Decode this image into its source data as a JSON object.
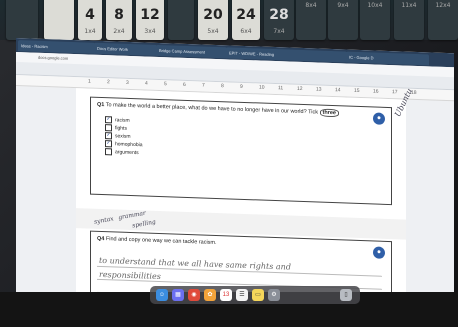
{
  "cards": [
    {
      "big": "",
      "small": "",
      "dark": true
    },
    {
      "big": "",
      "small": "",
      "dark": false
    },
    {
      "big": "4",
      "small": "1x4",
      "dark": false
    },
    {
      "big": "8",
      "small": "2x4",
      "dark": false
    },
    {
      "big": "12",
      "small": "3x4",
      "dark": false
    },
    {
      "big": "",
      "small": "",
      "dark": true
    },
    {
      "big": "20",
      "small": "5x4",
      "dark": false
    },
    {
      "big": "24",
      "small": "6x4",
      "dark": false
    },
    {
      "big": "28",
      "small": "7x4",
      "dark": true
    },
    {
      "big": "",
      "small": "8x4",
      "dark": true
    },
    {
      "big": "",
      "small": "9x4",
      "dark": true
    },
    {
      "big": "",
      "small": "10x4",
      "dark": true
    },
    {
      "big": "",
      "small": "11x4",
      "dark": true
    },
    {
      "big": "",
      "small": "12x4",
      "dark": true
    }
  ],
  "browser": {
    "tabs": [
      "Ideas - Racism",
      "Docs Editor Work",
      "Bridge Camp Assessment",
      "EPIT - WD/WE - Reading",
      "IC - Google D"
    ],
    "url": "docs.google.com"
  },
  "ruler": [
    "1",
    "2",
    "3",
    "4",
    "5",
    "6",
    "7",
    "8",
    "9",
    "10",
    "11",
    "12",
    "13",
    "14",
    "15",
    "16",
    "17",
    "18"
  ],
  "q1": {
    "number": "Q1",
    "text_a": "To make the world a better place, what do we have to no longer have in our world? Tick",
    "tick_word": "three",
    "options": [
      {
        "label": "racism",
        "checked": true
      },
      {
        "label": "fights",
        "checked": false
      },
      {
        "label": "sexism",
        "checked": true
      },
      {
        "label": "homophobia",
        "checked": true
      },
      {
        "label": "arguments",
        "checked": false
      }
    ],
    "margin_note": "Ubuntu"
  },
  "q4": {
    "number": "Q4",
    "text": "Find and copy one way we can tackle racism.",
    "margin_notes": [
      "syntax",
      "grammar",
      "spelling"
    ],
    "answer_line1": "to understand that we all have same rights and",
    "answer_line2": "responsibilities"
  },
  "dock": {
    "calendar_day": "13"
  }
}
